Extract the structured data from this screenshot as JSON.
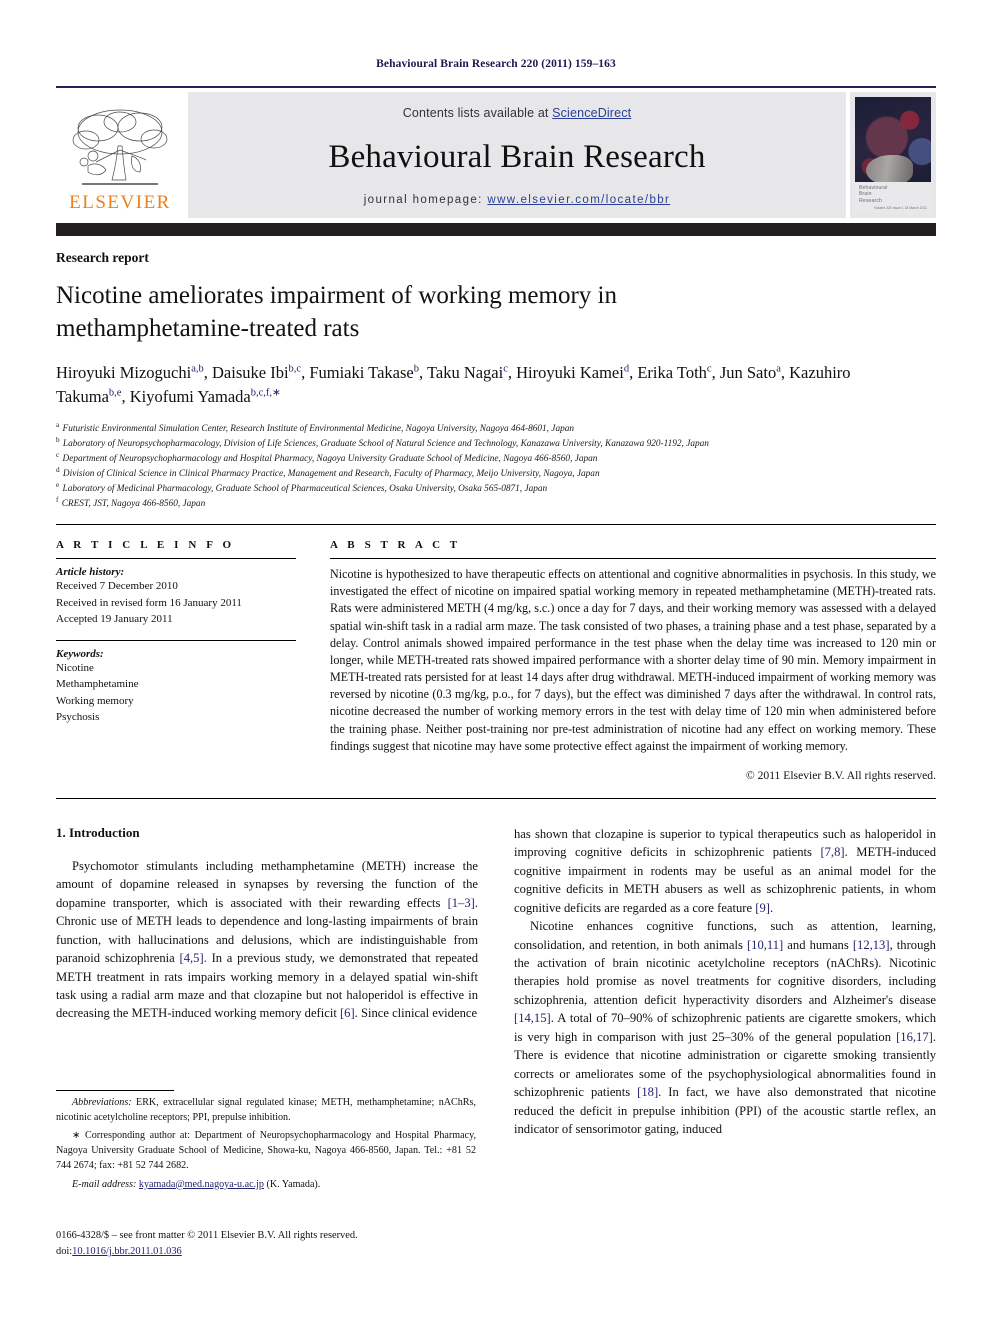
{
  "running_head": "Behavioural Brain Research 220 (2011) 159–163",
  "masthead": {
    "publisher_name": "ELSEVIER",
    "contents_prefix": "Contents lists available at ",
    "contents_link": "ScienceDirect",
    "journal_title": "Behavioural Brain Research",
    "homepage_prefix": "journal homepage:",
    "homepage_url": "www.elsevier.com/locate/bbr",
    "cover_caption": [
      "Behavioural",
      "Brain",
      "Research"
    ],
    "cover_caption_small": "Volume 220 Issue 1 15 March 2011"
  },
  "article": {
    "kind": "Research report",
    "title": "Nicotine ameliorates impairment of working memory in methamphetamine-treated rats",
    "authors": [
      {
        "name": "Hiroyuki Mizoguchi",
        "sup": "a,b",
        "sep": ", "
      },
      {
        "name": "Daisuke Ibi",
        "sup": "b,c",
        "sep": ", "
      },
      {
        "name": "Fumiaki Takase",
        "sup": "b",
        "sep": ", "
      },
      {
        "name": "Taku Nagai",
        "sup": "c",
        "sep": ", "
      },
      {
        "name": "Hiroyuki Kamei",
        "sup": "d",
        "sep": ", "
      },
      {
        "name": "Erika Toth",
        "sup": "c",
        "sep": ", "
      },
      {
        "name": "Jun Sato",
        "sup": "a",
        "sep": ", "
      },
      {
        "name": "Kazuhiro Takuma",
        "sup": "b,e",
        "sep": ", "
      },
      {
        "name": "Kiyofumi Yamada",
        "sup": "b,c,f,∗",
        "sep": ""
      }
    ],
    "affiliations": [
      {
        "mark": "a",
        "text": "Futuristic Environmental Simulation Center, Research Institute of Environmental Medicine, Nagoya University, Nagoya 464-8601, Japan"
      },
      {
        "mark": "b",
        "text": "Laboratory of Neuropsychopharmacology, Division of Life Sciences, Graduate School of Natural Science and Technology, Kanazawa University, Kanazawa 920-1192, Japan"
      },
      {
        "mark": "c",
        "text": "Department of Neuropsychopharmacology and Hospital Pharmacy, Nagoya University Graduate School of Medicine, Nagoya 466-8560, Japan"
      },
      {
        "mark": "d",
        "text": "Division of Clinical Science in Clinical Pharmacy Practice, Management and Research, Faculty of Pharmacy, Meijo University, Nagoya, Japan"
      },
      {
        "mark": "e",
        "text": "Laboratory of Medicinal Pharmacology, Graduate School of Pharmaceutical Sciences, Osaka University, Osaka 565-0871, Japan"
      },
      {
        "mark": "f",
        "text": "CREST, JST, Nagoya 466-8560, Japan"
      }
    ]
  },
  "article_info": {
    "heading": "A R T I C L E   I N F O",
    "history_label": "Article history:",
    "history": [
      "Received 7 December 2010",
      "Received in revised form 16 January 2011",
      "Accepted 19 January 2011"
    ],
    "keywords_label": "Keywords:",
    "keywords": [
      "Nicotine",
      "Methamphetamine",
      "Working memory",
      "Psychosis"
    ]
  },
  "abstract": {
    "heading": "A B S T R A C T",
    "text": "Nicotine is hypothesized to have therapeutic effects on attentional and cognitive abnormalities in psychosis. In this study, we investigated the effect of nicotine on impaired spatial working memory in repeated methamphetamine (METH)-treated rats. Rats were administered METH (4 mg/kg, s.c.) once a day for 7 days, and their working memory was assessed with a delayed spatial win-shift task in a radial arm maze. The task consisted of two phases, a training phase and a test phase, separated by a delay. Control animals showed impaired performance in the test phase when the delay time was increased to 120 min or longer, while METH-treated rats showed impaired performance with a shorter delay time of 90 min. Memory impairment in METH-treated rats persisted for at least 14 days after drug withdrawal. METH-induced impairment of working memory was reversed by nicotine (0.3 mg/kg, p.o., for 7 days), but the effect was diminished 7 days after the withdrawal. In control rats, nicotine decreased the number of working memory errors in the test with delay time of 120 min when administered before the training phase. Neither post-training nor pre-test administration of nicotine had any effect on working memory. These findings suggest that nicotine may have some protective effect against the impairment of working memory.",
    "copyright": "© 2011 Elsevier B.V. All rights reserved."
  },
  "introduction": {
    "section_number_title": "1.  Introduction",
    "left_paragraph_1_a": "Psychomotor stimulants including methamphetamine (METH) increase the amount of dopamine released in synapses by reversing the function of the dopamine transporter, which is associated with their rewarding effects ",
    "left_ref_1": "[1–3]",
    "left_paragraph_1_b": ". Chronic use of METH leads to dependence and long-lasting impairments of brain function, with hallucinations and delusions, which are indistinguishable from paranoid schizophrenia ",
    "left_ref_2": "[4,5]",
    "left_paragraph_1_c": ". In a previous study, we demonstrated that repeated METH treatment in rats impairs working memory in a delayed spatial win-shift task using a radial arm maze and that clozapine but not haloperidol is effective in decreasing the METH-induced working memory deficit ",
    "left_ref_3": "[6]",
    "left_paragraph_1_d": ". Since clinical evidence",
    "right_paragraph_1_a": "has shown that clozapine is superior to typical therapeutics such as haloperidol in improving cognitive deficits in schizophrenic patients ",
    "right_ref_1": "[7,8]",
    "right_paragraph_1_b": ". METH-induced cognitive impairment in rodents may be useful as an animal model for the cognitive deficits in METH abusers as well as schizophrenic patients, in whom cognitive deficits are regarded as a core feature ",
    "right_ref_2": "[9]",
    "right_paragraph_1_c": ".",
    "right_paragraph_2_a": "Nicotine enhances cognitive functions, such as attention, learning, consolidation, and retention, in both animals ",
    "right_ref_3": "[10,11]",
    "right_paragraph_2_b": " and humans ",
    "right_ref_4": "[12,13]",
    "right_paragraph_2_c": ", through the activation of brain nicotinic acetylcholine receptors (nAChRs). Nicotinic therapies hold promise as novel treatments for cognitive disorders, including schizophrenia, attention deficit hyperactivity disorders and Alzheimer's disease ",
    "right_ref_5": "[14,15]",
    "right_paragraph_2_d": ". A total of 70–90% of schizophrenic patients are cigarette smokers, which is very high in comparison with just 25–30% of the general population ",
    "right_ref_6": "[16,17]",
    "right_paragraph_2_e": ". There is evidence that nicotine administration or cigarette smoking transiently corrects or ameliorates some of the psychophysiological abnormalities found in schizophrenic patients ",
    "right_ref_7": "[18]",
    "right_paragraph_2_f": ". In fact, we have also demonstrated that nicotine reduced the deficit in prepulse inhibition (PPI) of the acoustic startle reflex, an indicator of sensorimotor gating, induced"
  },
  "footnotes": {
    "abbrev_label": "Abbreviations:",
    "abbrev_text": " ERK, extracellular signal regulated kinase; METH, methamphetamine; nAChRs, nicotinic acetylcholine receptors; PPI, prepulse inhibition.",
    "corresponding_marker": "∗",
    "corresponding_text": " Corresponding author at: Department of Neuropsychopharmacology and Hospital Pharmacy, Nagoya University Graduate School of Medicine, Showa-ku, Nagoya 466-8560, Japan. Tel.: +81 52 744 2674; fax: +81 52 744 2682.",
    "email_label": "E-mail address:",
    "email": "kyamada@med.nagoya-u.ac.jp",
    "email_suffix": " (K. Yamada)."
  },
  "imprint": {
    "issn_line": "0166-4328/$ – see front matter © 2011 Elsevier B.V. All rights reserved.",
    "doi_label": "doi:",
    "doi_value": "10.1016/j.bbr.2011.01.036"
  },
  "colors": {
    "link": "#2b3f94",
    "ref": "#23236e",
    "elsevier_orange": "#F07F1A",
    "masthead_bg": "#e7e7e9",
    "dark_bar": "#231f20"
  }
}
